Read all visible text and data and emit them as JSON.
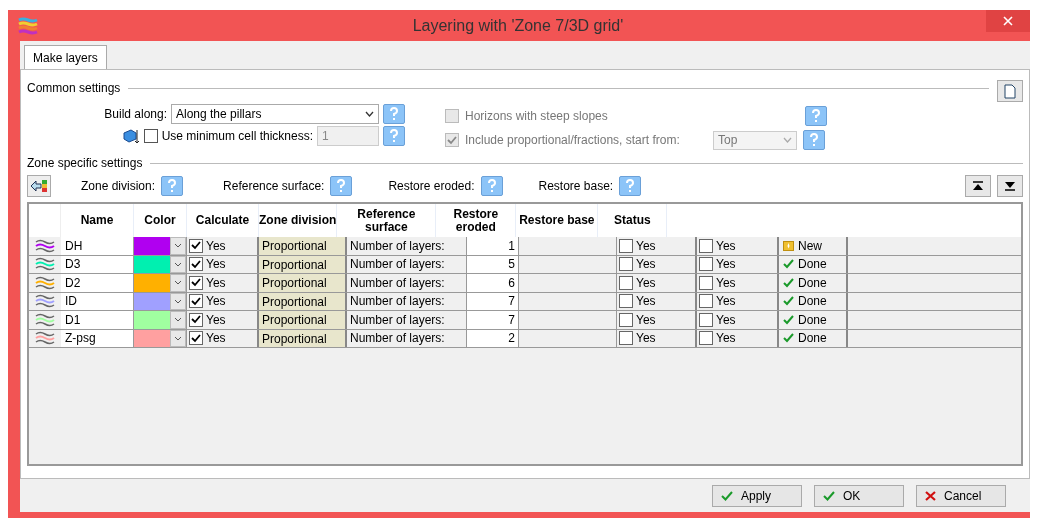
{
  "window": {
    "title": "Layering with 'Zone 7/3D grid'"
  },
  "tabs": [
    {
      "label": "Make layers",
      "selected": true
    }
  ],
  "common_settings": {
    "heading": "Common settings",
    "build_along": {
      "label": "Build along:",
      "value": "Along the pillars"
    },
    "min_cell_thickness": {
      "label": "Use minimum cell thickness:",
      "checked": false,
      "value": "1",
      "disabled": true
    },
    "steep_slopes": {
      "label": "Horizons with steep slopes",
      "checked": false,
      "disabled": true
    },
    "include_proportional": {
      "label": "Include proportional/fractions, start from:",
      "checked": true,
      "disabled": true,
      "value": "Top"
    }
  },
  "zone_settings": {
    "heading": "Zone specific settings",
    "help_labels": [
      "Zone division:",
      "Reference surface:",
      "Restore eroded:",
      "Restore base:"
    ]
  },
  "table": {
    "columns": [
      "Name",
      "Color",
      "Calculate",
      "Zone division",
      "Reference surface",
      "Restore eroded",
      "Restore base",
      "Status"
    ],
    "rows": [
      {
        "name": "DH",
        "color": "#b000f0",
        "calculate": {
          "checked": true,
          "label": "Yes"
        },
        "division": "Proportional",
        "layers_label": "Number of layers:",
        "layers": "1",
        "eroded": {
          "checked": false,
          "label": "Yes"
        },
        "base": {
          "checked": false,
          "label": "Yes"
        },
        "status": {
          "kind": "new",
          "label": "New"
        }
      },
      {
        "name": "D3",
        "color": "#00f0b0",
        "calculate": {
          "checked": true,
          "label": "Yes"
        },
        "division": "Proportional",
        "layers_label": "Number of layers:",
        "layers": "5",
        "eroded": {
          "checked": false,
          "label": "Yes"
        },
        "base": {
          "checked": false,
          "label": "Yes"
        },
        "status": {
          "kind": "done",
          "label": "Done"
        }
      },
      {
        "name": "D2",
        "color": "#ffb000",
        "calculate": {
          "checked": true,
          "label": "Yes"
        },
        "division": "Proportional",
        "layers_label": "Number of layers:",
        "layers": "6",
        "eroded": {
          "checked": false,
          "label": "Yes"
        },
        "base": {
          "checked": false,
          "label": "Yes"
        },
        "status": {
          "kind": "done",
          "label": "Done"
        }
      },
      {
        "name": "ID",
        "color": "#a0a0ff",
        "calculate": {
          "checked": true,
          "label": "Yes"
        },
        "division": "Proportional",
        "layers_label": "Number of layers:",
        "layers": "7",
        "eroded": {
          "checked": false,
          "label": "Yes"
        },
        "base": {
          "checked": false,
          "label": "Yes"
        },
        "status": {
          "kind": "done",
          "label": "Done"
        }
      },
      {
        "name": "D1",
        "color": "#a0ffa0",
        "calculate": {
          "checked": true,
          "label": "Yes"
        },
        "division": "Proportional",
        "layers_label": "Number of layers:",
        "layers": "7",
        "eroded": {
          "checked": false,
          "label": "Yes"
        },
        "base": {
          "checked": false,
          "label": "Yes"
        },
        "status": {
          "kind": "done",
          "label": "Done"
        }
      },
      {
        "name": "Z-psg",
        "color": "#ffa0a0",
        "calculate": {
          "checked": true,
          "label": "Yes"
        },
        "division": "Proportional",
        "layers_label": "Number of layers:",
        "layers": "2",
        "eroded": {
          "checked": false,
          "label": "Yes"
        },
        "base": {
          "checked": false,
          "label": "Yes"
        },
        "status": {
          "kind": "done",
          "label": "Done"
        }
      }
    ]
  },
  "buttons": [
    {
      "kind": "ok",
      "label": "Apply"
    },
    {
      "kind": "ok",
      "label": "OK"
    },
    {
      "kind": "cancel",
      "label": "Cancel"
    }
  ]
}
